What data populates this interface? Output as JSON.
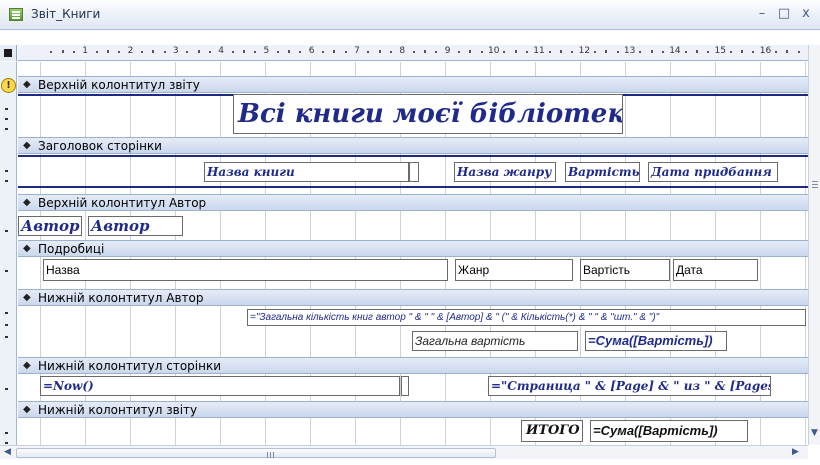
{
  "window": {
    "title": "Звіт_Книги",
    "minimize_glyph": "–",
    "maximize_glyph": "□",
    "close_glyph": "x"
  },
  "ruler": {
    "numbers": [
      "1",
      "2",
      "3",
      "4",
      "5",
      "6",
      "7",
      "8",
      "9",
      "10",
      "11",
      "12",
      "13",
      "14",
      "15",
      "16"
    ]
  },
  "sections": {
    "report_header": "Верхній колонтитул звіту",
    "page_header": "Заголовок сторінки",
    "author_header": "Верхній колонтитул Автор",
    "detail": "Подробиці",
    "author_footer": "Нижній колонтитул Автор",
    "page_footer": "Нижній колонтитул сторінки",
    "report_footer": "Нижній колонтитул звіту"
  },
  "report_header": {
    "title": "Всі книги моєї бібліотеки"
  },
  "page_header": {
    "col_book": "Назва книги",
    "col_genre": "Назва жанру",
    "col_price": "Вартість",
    "col_date": "Дата придбання"
  },
  "author_header": {
    "label": "Автор",
    "field": "Автор"
  },
  "detail": {
    "name": "Назва",
    "genre": "Жанр",
    "price": "Вартість",
    "date": "Дата"
  },
  "author_footer": {
    "count_expr": "=\"Загальна кількість книг автор \" & \" \" & [Автор] & \" (\" & Кількість(*) & \" \" & \"шт.\" & \")\"",
    "total_label": "Загальна вартість",
    "sum_expr": "=Сума([Вартість])"
  },
  "page_footer": {
    "now_expr": "=Now()",
    "page_expr": "=\"Страница \" & [Page] & \" из \" & [Pages]"
  },
  "report_footer": {
    "total_label": "ИТОГО",
    "sum_expr": "=Сума([Вартість])"
  },
  "icons": {
    "section_arrow": "◆",
    "warning": "!"
  }
}
